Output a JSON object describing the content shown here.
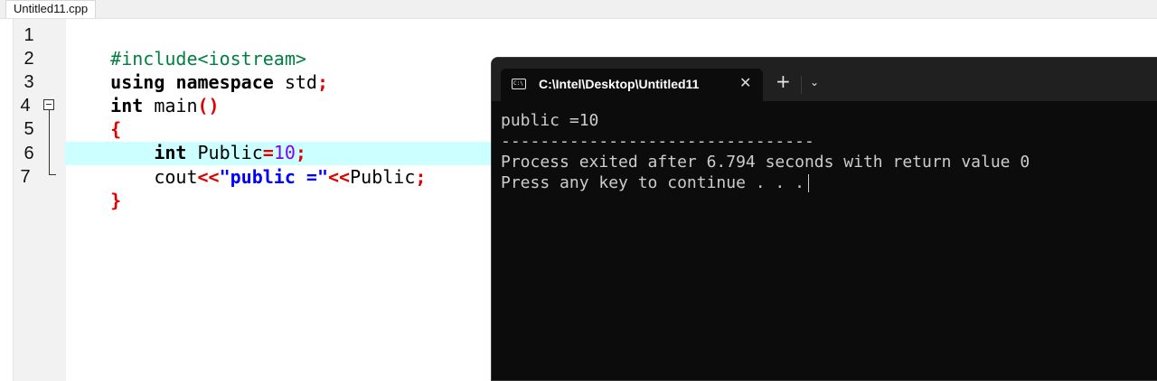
{
  "editor": {
    "tab_label": "Untitled11.cpp",
    "line_numbers": [
      "1",
      "2",
      "3",
      "4",
      "5",
      "6",
      "7"
    ],
    "lines": [
      [
        "#include<iostream>"
      ],
      [
        "using",
        " ",
        "namespace",
        " std",
        ";"
      ],
      [
        "int",
        " main",
        "()"
      ],
      [
        "{"
      ],
      [
        "    ",
        "int",
        " Public",
        "=",
        "10",
        ";"
      ],
      [
        "    cout",
        "<<",
        "\"public =\"",
        "<<",
        "Public",
        ";"
      ],
      [
        "}"
      ]
    ],
    "highlight_line": 6
  },
  "terminal": {
    "tab_title": "C:\\Intel\\Desktop\\Untitled11",
    "close_glyph": "✕",
    "new_tab_glyph": "+",
    "dropdown_glyph": "⌄",
    "icon_text": "C:\\",
    "output_lines": [
      "public =10",
      "--------------------------------",
      "Process exited after 6.794 seconds with return value 0",
      "Press any key to continue . . ."
    ]
  }
}
